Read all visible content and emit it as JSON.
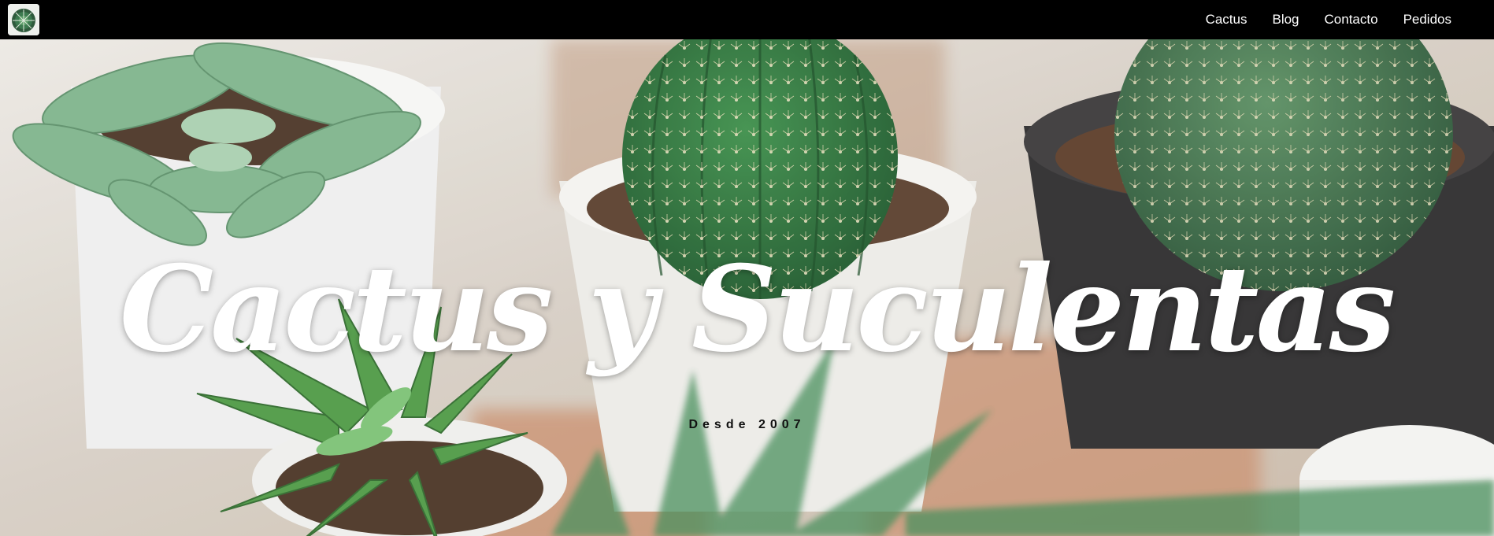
{
  "navbar": {
    "logo_icon": "cactus-logo-icon",
    "links": [
      {
        "label": "Cactus"
      },
      {
        "label": "Blog"
      },
      {
        "label": "Contacto"
      },
      {
        "label": "Pedidos"
      }
    ]
  },
  "hero": {
    "title": "Cactus y Suculentas",
    "subtitle": "Desde 2007",
    "background": "cactus-and-succulents-photo"
  },
  "colors": {
    "navbar_bg": "#000000",
    "nav_text": "#ffffff",
    "title_text": "#ffffff",
    "subtitle_text": "#111111"
  }
}
